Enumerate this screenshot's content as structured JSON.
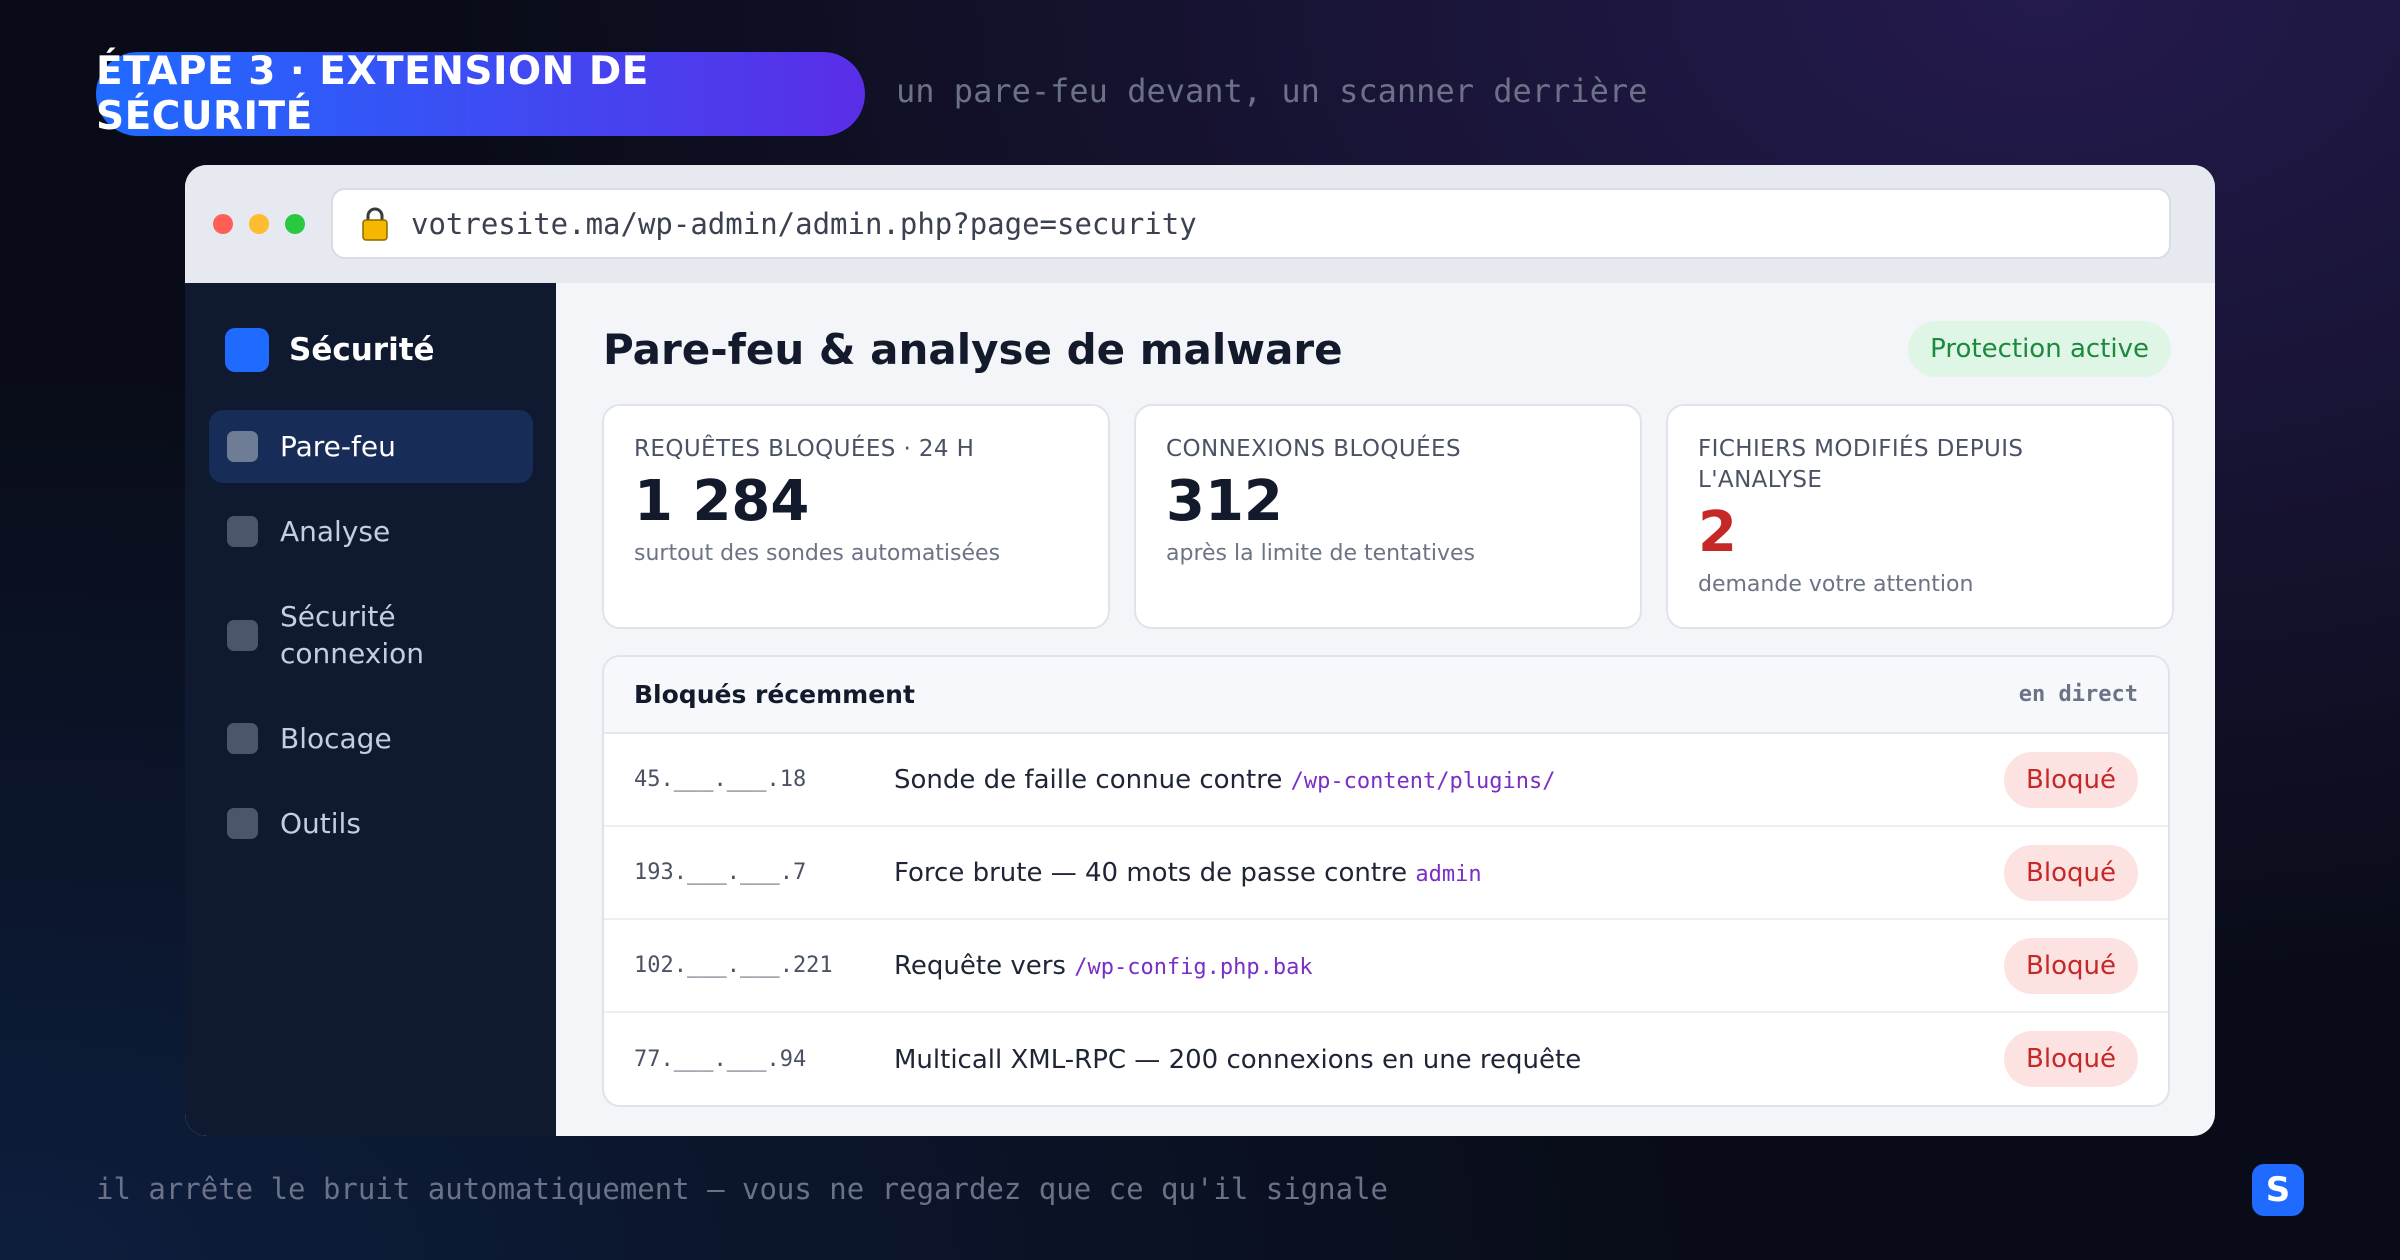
{
  "header": {
    "step_label": "ÉTAPE 3 · EXTENSION DE SÉCURITÉ",
    "tagline": "un pare-feu devant, un scanner derrière"
  },
  "browser": {
    "url": "votresite.ma/wp-admin/admin.php?page=security"
  },
  "sidebar": {
    "brand": "Sécurité",
    "items": [
      {
        "label": "Pare-feu",
        "active": true
      },
      {
        "label": "Analyse",
        "active": false
      },
      {
        "label": "Sécurité connexion",
        "active": false
      },
      {
        "label": "Blocage",
        "active": false
      },
      {
        "label": "Outils",
        "active": false
      }
    ]
  },
  "main": {
    "title": "Pare-feu & analyse de malware",
    "status": "Protection active",
    "cards": [
      {
        "label": "REQUÊTES BLOQUÉES · 24 H",
        "value": "1 284",
        "sub": "surtout des sondes automatisées"
      },
      {
        "label": "CONNEXIONS BLOQUÉES",
        "value": "312",
        "sub": "après la limite de tentatives"
      },
      {
        "label": "FICHIERS MODIFIÉS DEPUIS L'ANALYSE",
        "value": "2",
        "sub": "demande votre attention"
      }
    ],
    "panel": {
      "title": "Bloqués récemment",
      "live": "en direct",
      "rows": [
        {
          "ip": "45.___.___.18",
          "desc": "Sonde de faille connue contre",
          "code": "/wp-content/plugins/",
          "badge": "Bloqué"
        },
        {
          "ip": "193.___.___.7",
          "desc": "Force brute — 40 mots de passe contre",
          "code": "admin",
          "badge": "Bloqué"
        },
        {
          "ip": "102.___.___.221",
          "desc": "Requête vers",
          "code": "/wp-config.php.bak",
          "badge": "Bloqué"
        },
        {
          "ip": "77.___.___.94",
          "desc": "Multicall XML-RPC — 200 connexions en une requête",
          "code": "",
          "badge": "Bloqué"
        }
      ]
    }
  },
  "footer": {
    "caption": "il arrête le bruit automatiquement — vous ne regardez que ce qu'il signale",
    "logo_letter": "S"
  },
  "colors": {
    "accent": "#1f6bff",
    "accent_purple": "#5a2ee8",
    "sidebar_bg": "#0f1a30",
    "success": "#1c8a3c",
    "danger": "#c62828"
  }
}
